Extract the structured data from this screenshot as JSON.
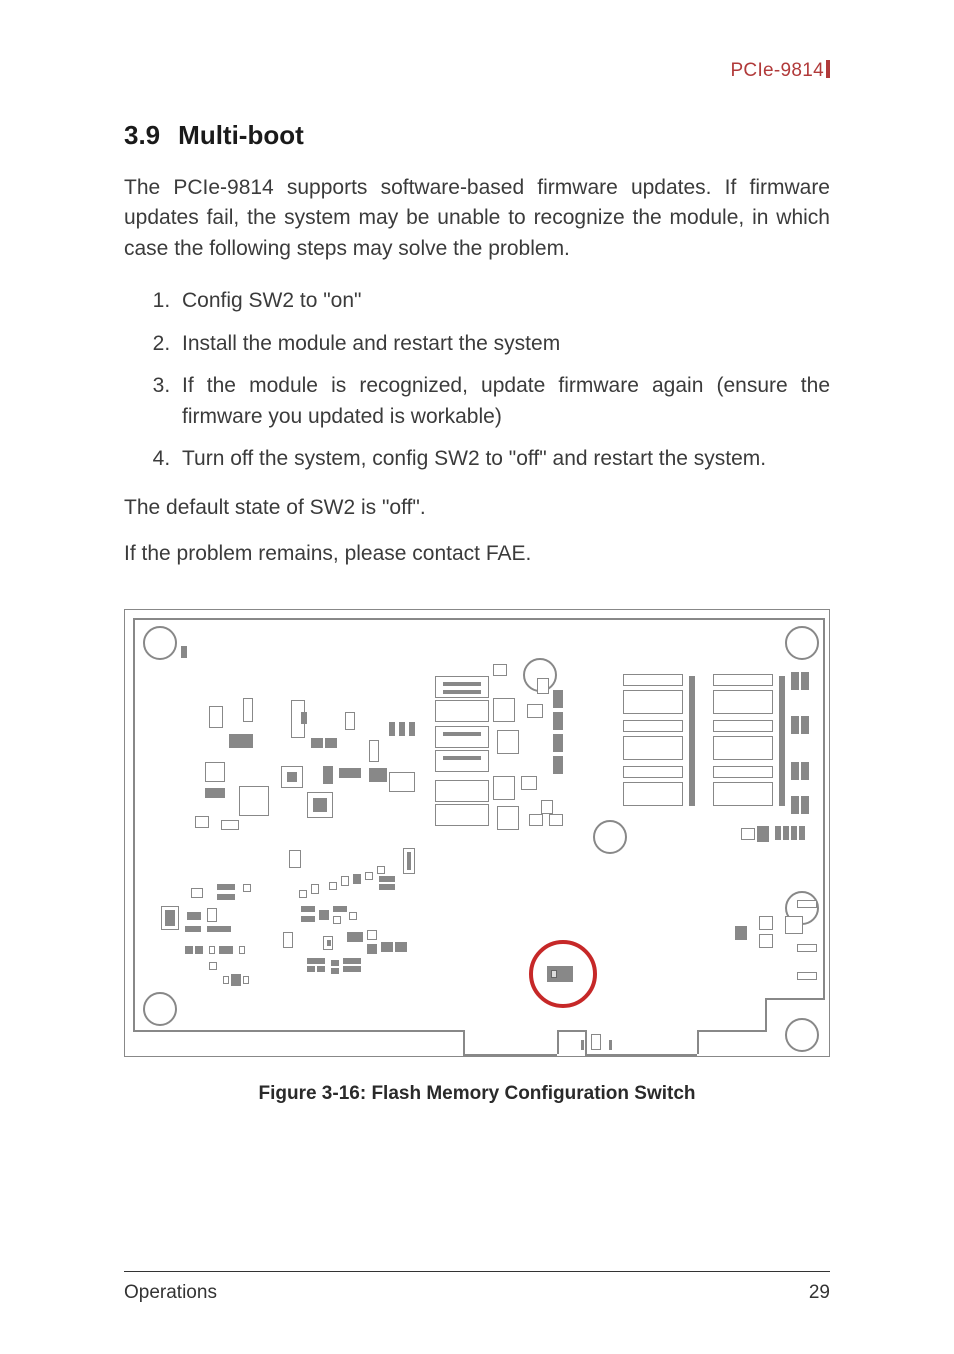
{
  "header": {
    "product": "PCIe-9814"
  },
  "section": {
    "number": "3.9",
    "title": "Multi-boot"
  },
  "paragraphs": {
    "intro": "The PCIe-9814 supports software-based firmware updates. If firmware updates fail, the system may be unable to recognize the module, in which case the following steps may solve the problem.",
    "default_state": "The default state of SW2 is \"off\".",
    "contact": "If the problem remains, please contact FAE."
  },
  "steps": [
    "Config SW2 to \"on\"",
    "Install the module and restart the system",
    "If the module is recognized, update firmware again (ensure the firmware you updated is workable)",
    "Turn off the system, config SW2 to \"off\" and restart the system."
  ],
  "figure": {
    "caption": "Figure 3-16: Flash Memory Configuration Switch"
  },
  "footer": {
    "chapter": "Operations",
    "page": "29"
  }
}
